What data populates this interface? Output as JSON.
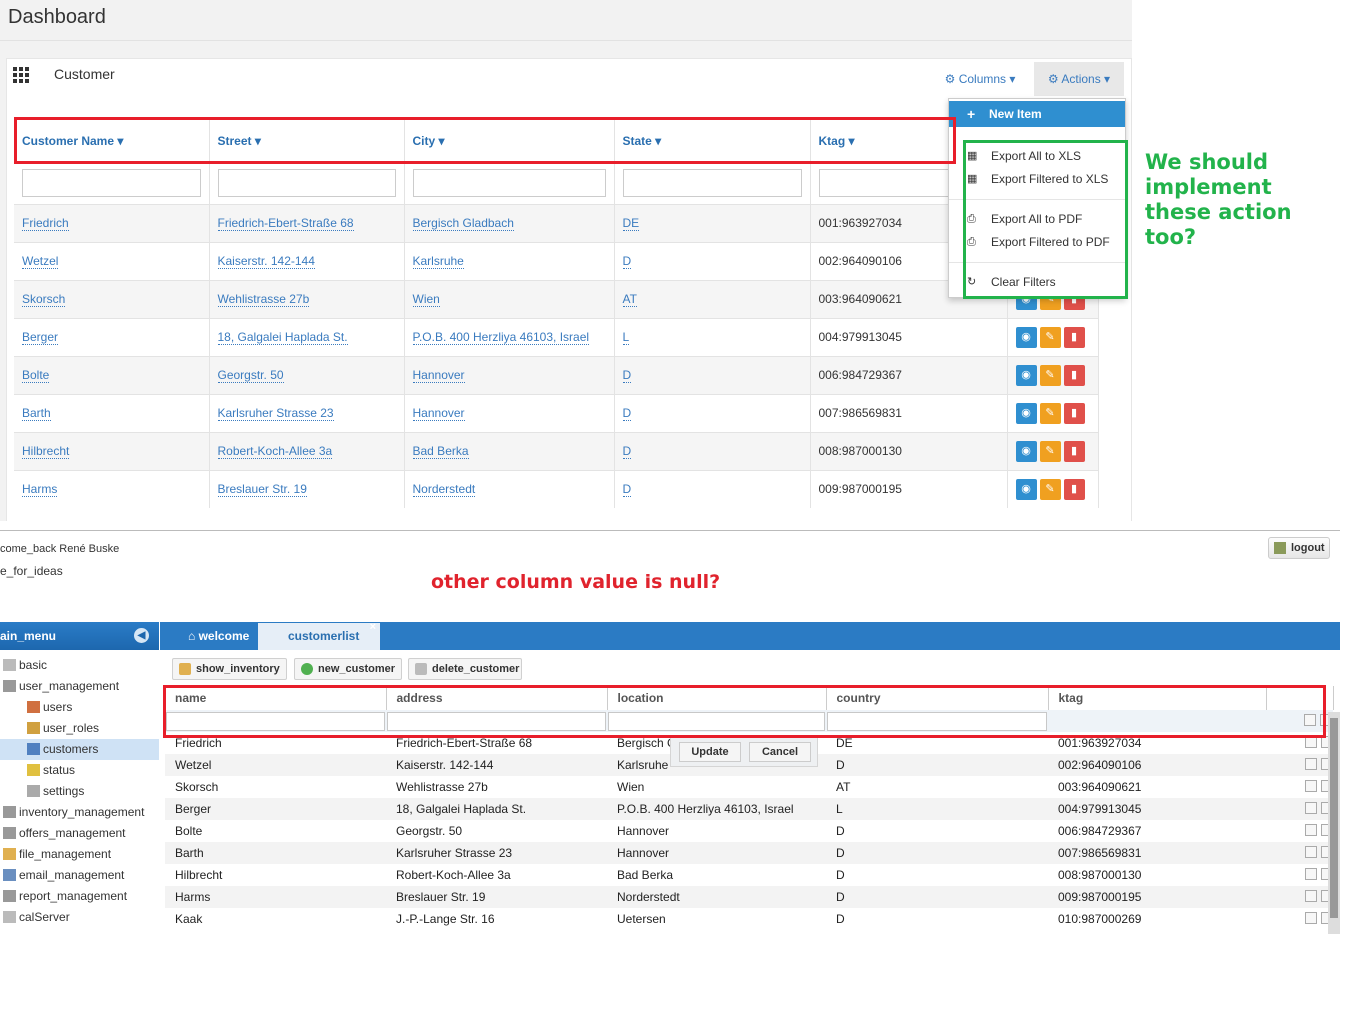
{
  "dashboard": {
    "title": "Dashboard",
    "panel_title": "Customer",
    "columns_label": "Columns",
    "actions_label": "Actions"
  },
  "top_table": {
    "headers": [
      "Customer Name",
      "Street",
      "City",
      "State",
      "Ktag"
    ],
    "rows": [
      [
        "Friedrich",
        "Friedrich-Ebert-Straße 68",
        "Bergisch Gladbach",
        "DE",
        "001:963927034"
      ],
      [
        "Wetzel",
        "Kaiserstr. 142-144",
        "Karlsruhe",
        "D",
        "002:964090106"
      ],
      [
        "Skorsch",
        "Wehlistrasse 27b",
        "Wien",
        "AT",
        "003:964090621"
      ],
      [
        "Berger",
        "18, Galgalei Haplada St.",
        "P.O.B. 400 Herzliya 46103, Israel",
        "L",
        "004:979913045"
      ],
      [
        "Bolte",
        "Georgstr. 50",
        "Hannover",
        "D",
        "006:984729367"
      ],
      [
        "Barth",
        "Karlsruher Strasse 23",
        "Hannover",
        "D",
        "007:986569831"
      ],
      [
        "Hilbrecht",
        "Robert-Koch-Allee 3a",
        "Bad Berka",
        "D",
        "008:987000130"
      ],
      [
        "Harms",
        "Breslauer Str. 19",
        "Norderstedt",
        "D",
        "009:987000195"
      ]
    ]
  },
  "actions_menu": {
    "new_item": "New Item",
    "items": [
      "Export All to XLS",
      "Export Filtered to XLS",
      "Export All to PDF",
      "Export Filtered to PDF",
      "Clear Filters"
    ]
  },
  "notes": {
    "green": "We should implement these action too?",
    "red": "other column value is null?"
  },
  "app": {
    "welcome": "come_back René Buske",
    "ideas": "e_for_ideas",
    "logout": "logout",
    "menu_title": "ain_menu",
    "menu": [
      "basic",
      "user_management",
      "users",
      "user_roles",
      "customers",
      "status",
      "settings",
      "inventory_management",
      "offers_management",
      "file_management",
      "email_management",
      "report_management",
      "calServer"
    ],
    "tabs": [
      "welcome",
      "customerlist"
    ],
    "toolbar": [
      "show_inventory",
      "new_customer",
      "delete_customer"
    ],
    "popup": {
      "update": "Update",
      "cancel": "Cancel"
    },
    "headers": [
      "name",
      "address",
      "location",
      "country",
      "ktag"
    ],
    "rows": [
      [
        "Friedrich",
        "Friedrich-Ebert-Straße 68",
        "Bergisch G",
        "DE",
        "001:963927034"
      ],
      [
        "Wetzel",
        "Kaiserstr. 142-144",
        "Karlsruhe",
        "D",
        "002:964090106"
      ],
      [
        "Skorsch",
        "Wehlistrasse 27b",
        "Wien",
        "AT",
        "003:964090621"
      ],
      [
        "Berger",
        "18, Galgalei Haplada St.",
        "P.O.B. 400 Herzliya 46103, Israel",
        "L",
        "004:979913045"
      ],
      [
        "Bolte",
        "Georgstr. 50",
        "Hannover",
        "D",
        "006:984729367"
      ],
      [
        "Barth",
        "Karlsruher Strasse 23",
        "Hannover",
        "D",
        "007:986569831"
      ],
      [
        "Hilbrecht",
        "Robert-Koch-Allee 3a",
        "Bad Berka",
        "D",
        "008:987000130"
      ],
      [
        "Harms",
        "Breslauer Str. 19",
        "Norderstedt",
        "D",
        "009:987000195"
      ],
      [
        "Kaak",
        "J.-P.-Lange Str. 16",
        "Uetersen",
        "D",
        "010:987000269"
      ]
    ]
  },
  "colors": {
    "accent": "#2b7bc4",
    "red_annotation": "#e81e2a",
    "green_annotation": "#22b34b"
  }
}
